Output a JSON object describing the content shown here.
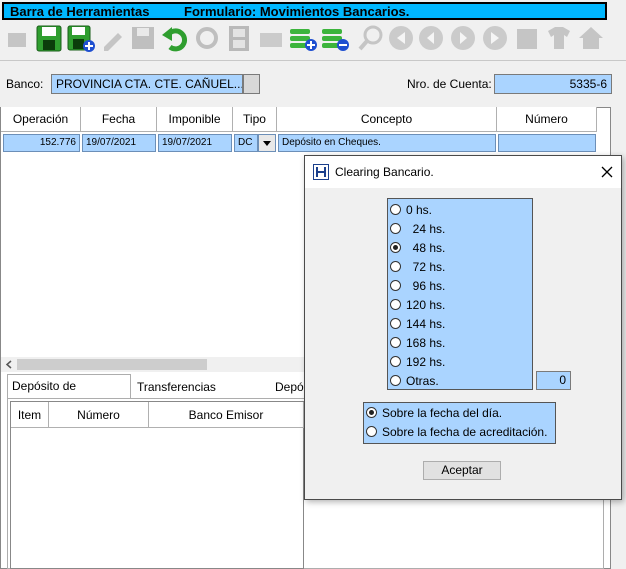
{
  "toolbar": {
    "title": "Barra de Herramientas",
    "form_title": "Formulario: Movimientos Bancarios.",
    "buttons": [
      {
        "icon": "first-icon",
        "enabled": false
      },
      {
        "icon": "save-icon",
        "enabled": true
      },
      {
        "icon": "save-new-icon",
        "enabled": true
      },
      {
        "icon": "edit-icon",
        "enabled": false
      },
      {
        "icon": "save-disk-icon",
        "enabled": false
      },
      {
        "icon": "undo-icon",
        "enabled": true
      },
      {
        "icon": "refresh-icon",
        "enabled": false
      },
      {
        "icon": "film-icon",
        "enabled": false
      },
      {
        "icon": "folder-icon",
        "enabled": false
      },
      {
        "icon": "add-row-icon",
        "enabled": true
      },
      {
        "icon": "remove-row-icon",
        "enabled": true
      },
      {
        "icon": "search-icon",
        "enabled": false
      },
      {
        "icon": "first-record-icon",
        "enabled": false
      },
      {
        "icon": "prev-record-icon",
        "enabled": false
      },
      {
        "icon": "next-record-icon",
        "enabled": false
      },
      {
        "icon": "last-record-icon",
        "enabled": false
      },
      {
        "icon": "tools-icon",
        "enabled": false
      },
      {
        "icon": "shirt-icon",
        "enabled": false
      },
      {
        "icon": "home-icon",
        "enabled": false
      }
    ]
  },
  "form": {
    "bank_label": "Banco:",
    "bank_value": "PROVINCIA CTA. CTE. CAÑUEL...",
    "account_label": "Nro. de Cuenta:",
    "account_value": "5335-6"
  },
  "grid": {
    "columns": [
      "Operación",
      "Fecha",
      "Imponible",
      "Tipo",
      "Concepto",
      "Número"
    ],
    "row": {
      "operacion": "152.776",
      "fecha": "19/07/2021",
      "imponible": "19/07/2021",
      "tipo": "DC",
      "concepto": "Depósito en Cheques.",
      "numero": ""
    }
  },
  "tabs": [
    "Depósito de Cheques",
    "Transferencias Bancarias",
    "Depó"
  ],
  "subgrid": {
    "columns": [
      "Item",
      "Número",
      "Banco Emisor"
    ]
  },
  "dialog": {
    "title": "Clearing Bancario.",
    "options": [
      "0 hs.",
      "  24 hs.",
      "  48 hs.",
      "  72 hs.",
      "  96 hs.",
      "120 hs.",
      "144 hs.",
      "168 hs.",
      "192 hs.",
      "Otras."
    ],
    "selected_option": "  48 hs.",
    "otras_value": "0",
    "date_options": [
      "Sobre la fecha del día.",
      "Sobre la fecha de acreditación."
    ],
    "selected_date_option": "Sobre la fecha del día.",
    "accept_label": "Aceptar"
  }
}
